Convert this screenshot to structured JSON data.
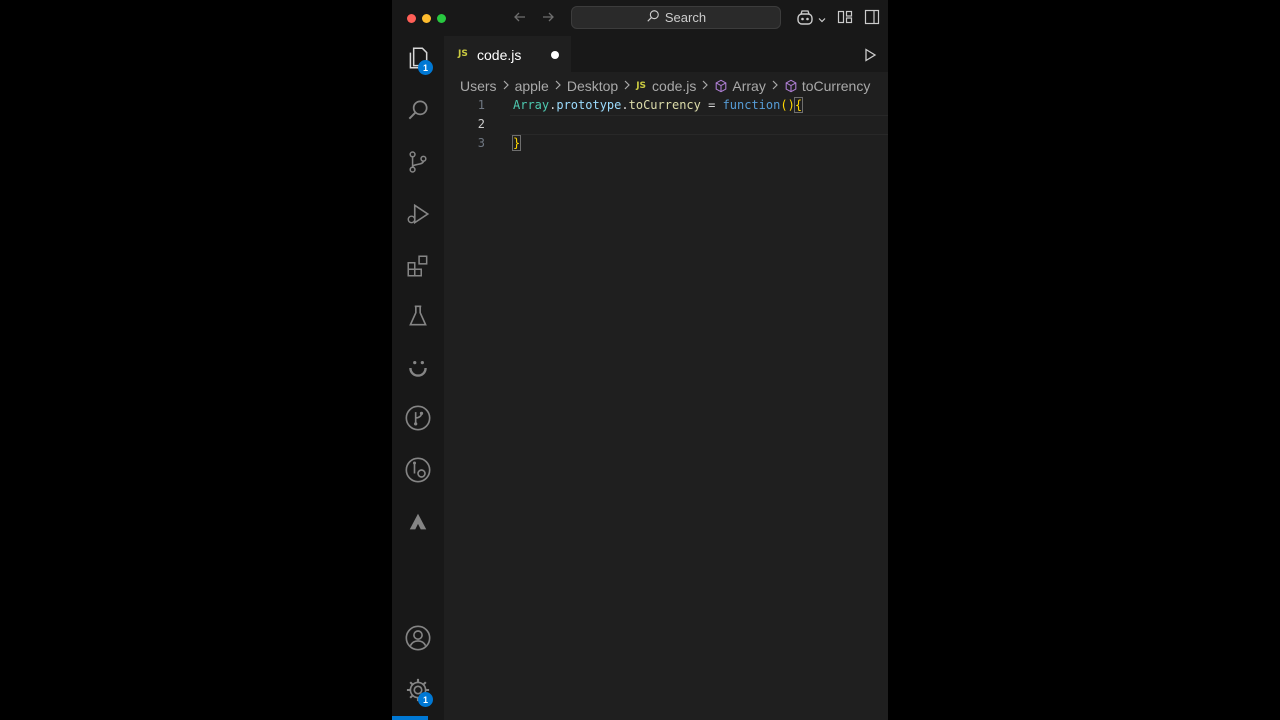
{
  "window": {
    "search_label": "Search"
  },
  "activity_bar": {
    "explorer_badge": "1",
    "settings_badge": "1"
  },
  "tab": {
    "label": "code.js",
    "file_type": "JS"
  },
  "breadcrumb": {
    "items": [
      "Users",
      "apple",
      "Desktop",
      "code.js",
      "Array",
      "toCurrency"
    ],
    "file_type": "JS"
  },
  "editor": {
    "lines": [
      {
        "number": "1",
        "tokens": [
          "Array",
          ".",
          "prototype",
          ".",
          "toCurrency",
          " = ",
          "function",
          "()",
          "{"
        ]
      },
      {
        "number": "2",
        "tokens": []
      },
      {
        "number": "3",
        "tokens": [
          "}"
        ]
      }
    ]
  },
  "colors": {
    "accent": "#0078d4",
    "editor_bg": "#1f1f1f",
    "sidebar_bg": "#181818"
  }
}
